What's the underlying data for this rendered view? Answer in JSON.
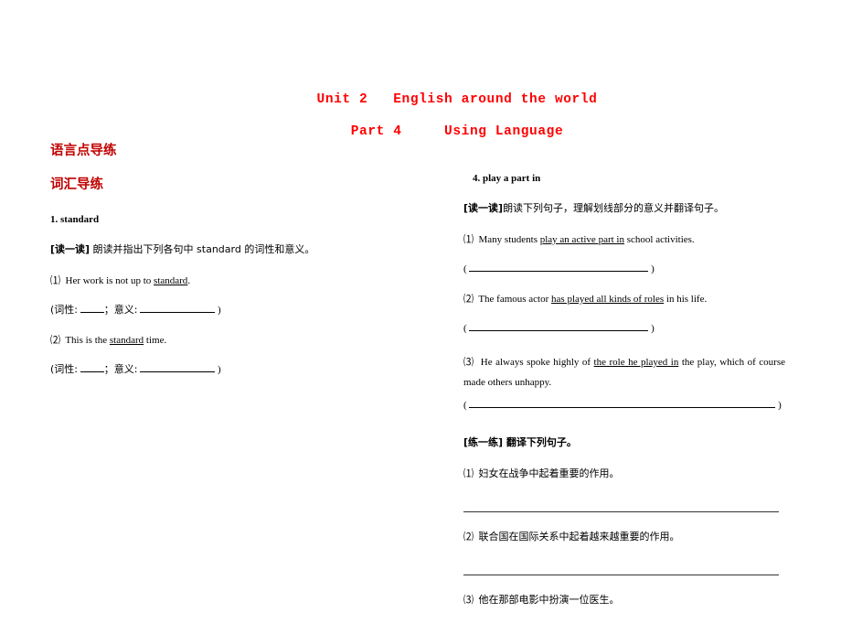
{
  "title": {
    "unit": "Unit 2   English around the world",
    "part": "Part 4     Using Language",
    "color": "#ff0000"
  },
  "left_column": {
    "section_heading": "语言点导练",
    "sub_heading": "词汇导练",
    "heading_color": "#c00000",
    "entry": {
      "number_title": "1. standard",
      "instruction_tag": "[读一读]",
      "instruction_text": " 朗读并指出下列各句中 standard 的词性和意义。",
      "items": [
        {
          "marker": "⑴",
          "before": "Her work is not up to ",
          "underlined": "standard",
          "after": "."
        },
        {
          "marker": "⑵",
          "before": "This is the ",
          "underlined": "standard",
          "after": " time."
        }
      ],
      "blank_prefix": "(词性:",
      "blank_middle": "；意义:",
      "blank_suffix": ")"
    }
  },
  "right_column": {
    "entry": {
      "number_title": "4. play a part in",
      "instruction_tag": "[读一读]",
      "instruction_text": "朗读下列句子，理解划线部分的意义并翻译句子。",
      "items": [
        {
          "marker": "⑴",
          "before": "Many students ",
          "underlined": "play an active part in",
          "after": " school activities.",
          "blank_width": "fill"
        },
        {
          "marker": "⑵",
          "before": "The famous actor ",
          "underlined": "has played all kinds of roles",
          "after": " in his life.",
          "blank_width": "fill"
        },
        {
          "marker": "⑶",
          "before": "He always spoke highly of ",
          "underlined": "the role he played in",
          "after": " the play, which of course made others unhappy.",
          "blank_width": "wide"
        }
      ],
      "blank_open": "(",
      "blank_close": ")"
    },
    "practice": {
      "tag": "[练一练]",
      "title": " 翻译下列句子。",
      "items": [
        {
          "marker": "⑴",
          "text": "妇女在战争中起着重要的作用。"
        },
        {
          "marker": "⑵",
          "text": "联合国在国际关系中起着越来越重要的作用。"
        },
        {
          "marker": "⑶",
          "text": "他在那部电影中扮演一位医生。"
        }
      ]
    }
  }
}
